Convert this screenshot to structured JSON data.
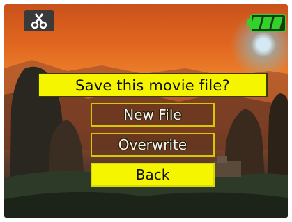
{
  "status_bar": {
    "mode_icon": "scissors-icon",
    "battery_icon": "battery-full-icon",
    "battery_level": 1.0,
    "accent_color": "#32d22a"
  },
  "dialog": {
    "title": "Save this movie file?",
    "options": [
      {
        "label": "New File",
        "selected": false
      },
      {
        "label": "Overwrite",
        "selected": false
      },
      {
        "label": "Back",
        "selected": true
      }
    ],
    "highlight_color": "#f5f500",
    "border_color": "#d8c800"
  }
}
